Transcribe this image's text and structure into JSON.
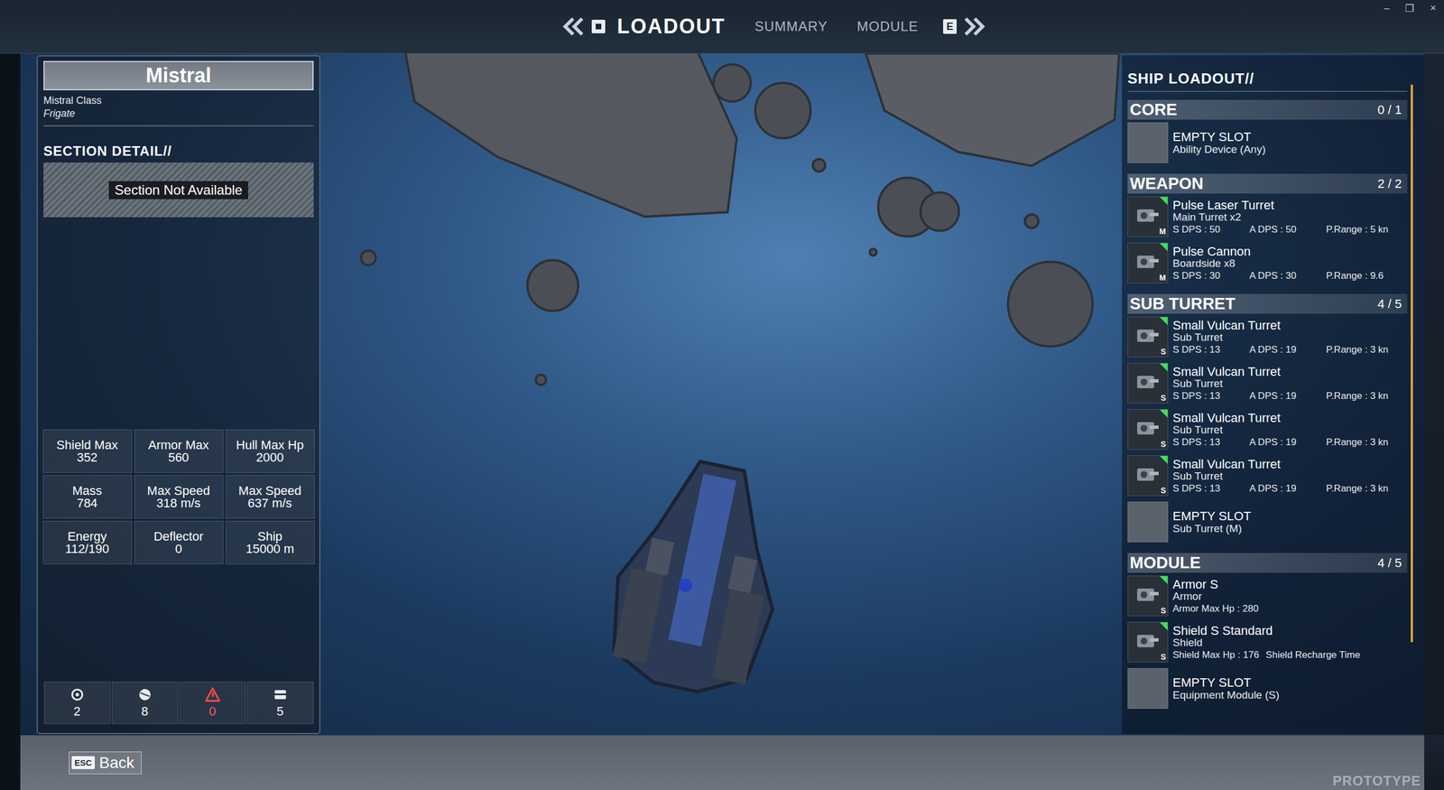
{
  "window_controls": [
    "–",
    "❐",
    "×"
  ],
  "nav": {
    "items": [
      {
        "label": "LOADOUT",
        "selected": true
      },
      {
        "label": "SUMMARY",
        "selected": false
      },
      {
        "label": "MODULE",
        "selected": false
      }
    ],
    "next_key": "E"
  },
  "ship": {
    "name": "Mistral",
    "class": "Mistral Class",
    "type": "Frigate"
  },
  "section_detail": {
    "title": "SECTION DETAIL//",
    "status": "Section Not Available"
  },
  "stats": [
    {
      "label": "Shield Max",
      "value": "352"
    },
    {
      "label": "Armor Max",
      "value": "560"
    },
    {
      "label": "Hull Max Hp",
      "value": "2000"
    },
    {
      "label": "Mass",
      "value": "784"
    },
    {
      "label": "Max Speed",
      "value": "318 m/s"
    },
    {
      "label": "Max Speed",
      "value": "637 m/s"
    },
    {
      "label": "Energy",
      "value": "112/190"
    },
    {
      "label": "Deflector",
      "value": "0"
    },
    {
      "label": "Ship",
      "value": "15000 m"
    }
  ],
  "resources": [
    {
      "value": "2",
      "warning": false
    },
    {
      "value": "8",
      "warning": false
    },
    {
      "value": "0",
      "warning": true
    },
    {
      "value": "5",
      "warning": false
    }
  ],
  "loadout": {
    "title": "SHIP LOADOUT//",
    "sections": [
      {
        "title": "CORE",
        "count": "0 / 1",
        "items": [
          {
            "kind": "empty",
            "name": "EMPTY SLOT",
            "subtitle": "Ability Device (Any)",
            "size": "",
            "stats": []
          }
        ]
      },
      {
        "title": "WEAPON",
        "count": "2 / 2",
        "items": [
          {
            "kind": "equipped",
            "name": "Pulse Laser Turret",
            "subtitle": "Main Turret x2",
            "size": "M",
            "stats": [
              "S DPS : 50",
              "A DPS : 50",
              "P.Range : 5 kn"
            ]
          },
          {
            "kind": "equipped",
            "name": "Pulse Cannon",
            "subtitle": "Boardside x8",
            "size": "M",
            "stats": [
              "S DPS : 30",
              "A DPS : 30",
              "P.Range : 9.6"
            ]
          }
        ]
      },
      {
        "title": "SUB TURRET",
        "count": "4 / 5",
        "items": [
          {
            "kind": "equipped",
            "name": "Small Vulcan Turret",
            "subtitle": "Sub Turret",
            "size": "S",
            "stats": [
              "S DPS : 13",
              "A DPS : 19",
              "P.Range : 3 kn"
            ]
          },
          {
            "kind": "equipped",
            "name": "Small Vulcan Turret",
            "subtitle": "Sub Turret",
            "size": "S",
            "stats": [
              "S DPS : 13",
              "A DPS : 19",
              "P.Range : 3 kn"
            ]
          },
          {
            "kind": "equipped",
            "name": "Small Vulcan Turret",
            "subtitle": "Sub Turret",
            "size": "S",
            "stats": [
              "S DPS : 13",
              "A DPS : 19",
              "P.Range : 3 kn"
            ]
          },
          {
            "kind": "equipped",
            "name": "Small Vulcan Turret",
            "subtitle": "Sub Turret",
            "size": "S",
            "stats": [
              "S DPS : 13",
              "A DPS : 19",
              "P.Range : 3 kn"
            ]
          },
          {
            "kind": "empty",
            "name": "EMPTY SLOT",
            "subtitle": "Sub Turret (M)",
            "size": "",
            "stats": []
          }
        ]
      },
      {
        "title": "MODULE",
        "count": "4 / 5",
        "items": [
          {
            "kind": "equipped",
            "name": "Armor S",
            "subtitle": "Armor",
            "size": "S",
            "stats": [
              "Armor Max Hp : 280"
            ]
          },
          {
            "kind": "equipped",
            "name": "Shield S Standard",
            "subtitle": "Shield",
            "size": "S",
            "stats": [
              "Shield Max Hp : 176",
              "Shield Recharge Time"
            ]
          },
          {
            "kind": "empty",
            "name": "EMPTY SLOT",
            "subtitle": "Equipment Module (S)",
            "size": "",
            "stats": []
          }
        ]
      }
    ]
  },
  "back": {
    "key": "ESC",
    "label": "Back"
  },
  "watermark": "PROTOTYPE"
}
